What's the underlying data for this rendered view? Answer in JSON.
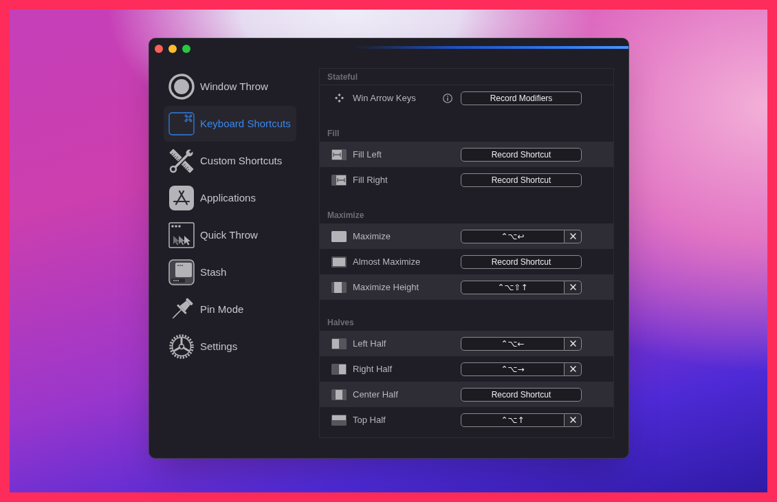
{
  "sidebar": {
    "items": [
      {
        "label": "Window Throw",
        "kind": "throw",
        "selected": false
      },
      {
        "label": "Keyboard Shortcuts",
        "kind": "keyboard",
        "selected": true
      },
      {
        "label": "Custom Shortcuts",
        "kind": "tools",
        "selected": false
      },
      {
        "label": "Applications",
        "kind": "apps",
        "selected": false
      },
      {
        "label": "Quick Throw",
        "kind": "quick",
        "selected": false
      },
      {
        "label": "Stash",
        "kind": "stash",
        "selected": false
      },
      {
        "label": "Pin Mode",
        "kind": "pin",
        "selected": false
      },
      {
        "label": "Settings",
        "kind": "settings",
        "selected": false
      }
    ]
  },
  "sections": [
    {
      "title": "Stateful",
      "rows": [
        {
          "label": "Win Arrow Keys",
          "kind": "arrows",
          "shaded": false,
          "info": true,
          "button": "Record Modifiers"
        }
      ]
    },
    {
      "title": "Fill",
      "rows": [
        {
          "label": "Fill Left",
          "kind": "fill-left",
          "shaded": true,
          "button": "Record Shortcut"
        },
        {
          "label": "Fill Right",
          "kind": "fill-right",
          "shaded": false,
          "button": "Record Shortcut"
        }
      ]
    },
    {
      "title": "Maximize",
      "rows": [
        {
          "label": "Maximize",
          "kind": "maximize",
          "shaded": true,
          "shortcut": "⌃⌥↩"
        },
        {
          "label": "Almost Maximize",
          "kind": "almost-maximize",
          "shaded": false,
          "button": "Record Shortcut"
        },
        {
          "label": "Maximize Height",
          "kind": "maximize-height",
          "shaded": true,
          "shortcut": "⌃⌥⇧↑"
        }
      ]
    },
    {
      "title": "Halves",
      "rows": [
        {
          "label": "Left Half",
          "kind": "left-half",
          "shaded": true,
          "shortcut": "⌃⌥←"
        },
        {
          "label": "Right Half",
          "kind": "right-half",
          "shaded": false,
          "shortcut": "⌃⌥→"
        },
        {
          "label": "Center Half",
          "kind": "center-half",
          "shaded": true,
          "button": "Record Shortcut"
        },
        {
          "label": "Top Half",
          "kind": "top-half",
          "shaded": false,
          "shortcut": "⌃⌥↑"
        }
      ]
    }
  ]
}
